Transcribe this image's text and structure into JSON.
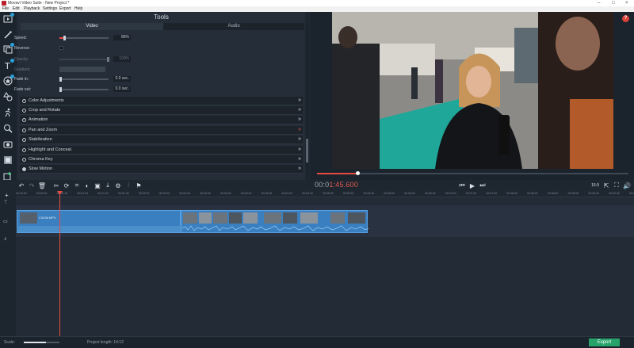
{
  "window": {
    "title": "Movavi Video Suite - New Project *"
  },
  "menu": [
    "File",
    "Edit",
    "Playback",
    "Settings",
    "Export",
    "Help"
  ],
  "tools_panel": {
    "title": "Tools",
    "tabs": [
      "Video",
      "Audio"
    ],
    "properties": [
      {
        "label": "Speed:",
        "value": "86%",
        "level": 0.08
      },
      {
        "label": "Reverse:"
      },
      {
        "label": "Opacity:",
        "value": "100%",
        "level": 1.0,
        "disabled": true
      },
      {
        "label": "Gradient:",
        "disabled": true
      },
      {
        "label": "Fade in:",
        "value": "0.0 sec.",
        "level": 0.0
      },
      {
        "label": "Fade out:",
        "value": "0.0 sec.",
        "level": 0.0
      }
    ],
    "accordion": [
      {
        "label": "Color Adjustments",
        "chevron": "»"
      },
      {
        "label": "Crop and Rotate",
        "chevron": "»"
      },
      {
        "label": "Animation",
        "chevron": "»"
      },
      {
        "label": "Pan and Zoom",
        "chevron": "»",
        "highlight": true
      },
      {
        "label": "Stabilization",
        "chevron": "»"
      },
      {
        "label": "Highlight and Conceal",
        "chevron": "»"
      },
      {
        "label": "Chroma Key",
        "chevron": "»"
      },
      {
        "label": "Slow Motion",
        "chevron": "»",
        "checked": true
      }
    ]
  },
  "player": {
    "timecode_dim": "00:0",
    "timecode_now": "1:45.600",
    "progress": 0.13,
    "help_label": "?",
    "aspect_label": "16:9"
  },
  "timeline": {
    "ruler_ticks": [
      "00:00:00",
      "00:00:20",
      "00:00:40",
      "00:01:00",
      "00:01:20",
      "00:01:40",
      "00:02:00",
      "00:02:20",
      "00:02:40",
      "00:03:00",
      "00:03:20",
      "00:03:40",
      "00:04:00",
      "00:04:20",
      "00:04:40",
      "00:05:00",
      "00:05:20",
      "00:05:40",
      "00:06:00",
      "00:06:20",
      "00:06:40",
      "00:07:00",
      "00:07:20",
      "00:07:40",
      "00:08:00",
      "00:08:20",
      "00:08:40",
      "00:09:00",
      "00:09:20",
      "00:09:40",
      "00:10:00"
    ],
    "clip_label": "C0036.MP4"
  },
  "status": {
    "scale_label": "Scale:",
    "zoom_level": 0.62,
    "project_length": "Project length:  14:12"
  },
  "export_label": "Export",
  "colors": {
    "accent": "#e74b42",
    "export": "#27a36a",
    "clip": "#3a7fbf"
  }
}
